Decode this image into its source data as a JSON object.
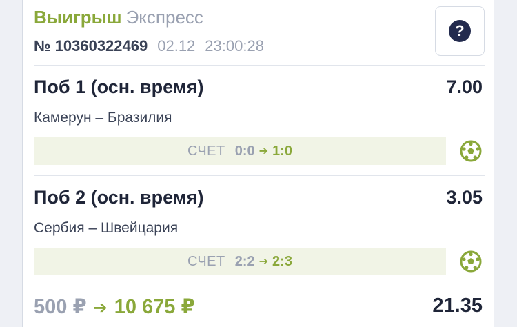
{
  "header": {
    "status": "Выигрыш",
    "bet_type": "Экспресс",
    "bet_number": "№ 10360322469",
    "date": "02.12",
    "time": "23:00:28",
    "help_label": "?"
  },
  "bets": [
    {
      "title": "Поб 1 (осн. время)",
      "coefficient": "7.00",
      "match": "Камерун – Бразилия",
      "score_label": "СЧЕТ",
      "score_from": "0:0",
      "score_to": "1:0"
    },
    {
      "title": "Поб 2 (осн. время)",
      "coefficient": "3.05",
      "match": "Сербия – Швейцария",
      "score_label": "СЧЕТ",
      "score_from": "2:2",
      "score_to": "2:3"
    }
  ],
  "footer": {
    "stake": "500 ₽",
    "winnings": "10 675 ₽",
    "total_coefficient": "21.35"
  },
  "icons": {
    "help": "question-circle-icon",
    "sport": "soccer-ball-icon",
    "arrow": "arrow-right-icon"
  },
  "colors": {
    "win_green": "#8aa83a",
    "muted": "#9aa1b1",
    "dark": "#1f2538",
    "help_bg": "#232b4e",
    "score_bg": "#f1f4e6"
  }
}
